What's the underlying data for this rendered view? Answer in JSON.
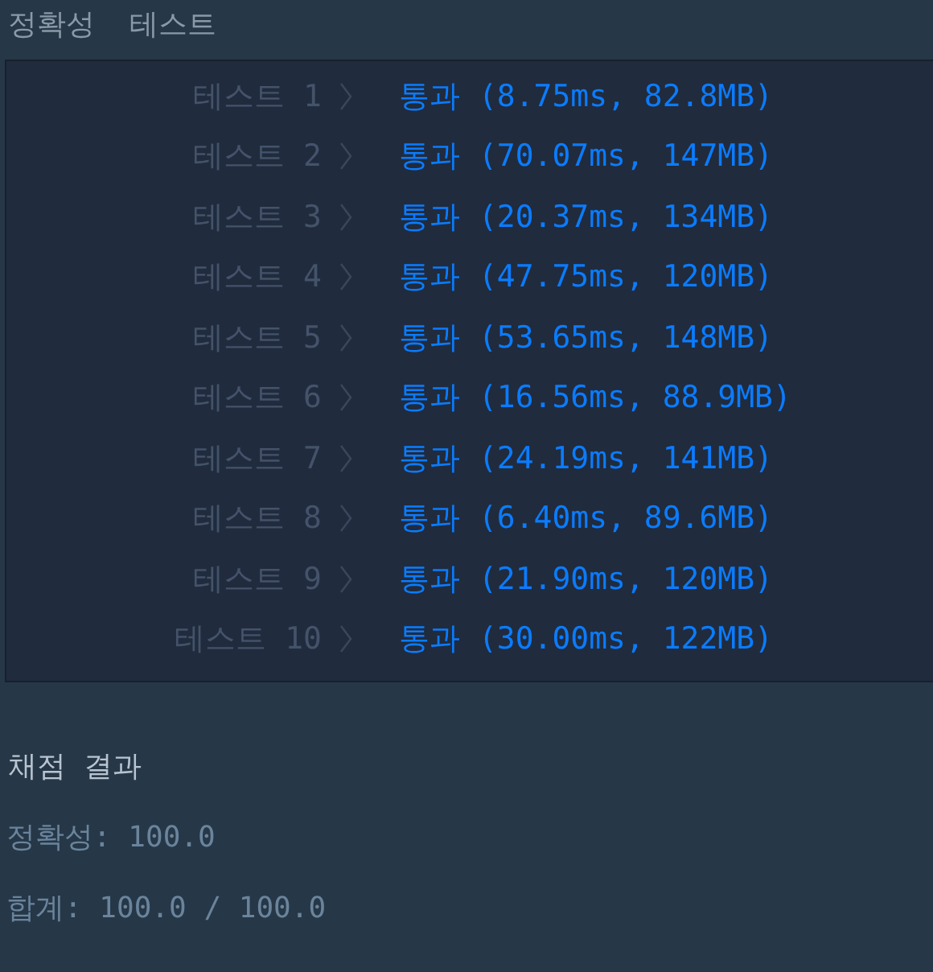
{
  "section_title": "정확성  테스트",
  "tests": [
    {
      "label": "테스트 1",
      "status": "통과",
      "detail": "(8.75ms, 82.8MB)"
    },
    {
      "label": "테스트 2",
      "status": "통과",
      "detail": "(70.07ms, 147MB)"
    },
    {
      "label": "테스트 3",
      "status": "통과",
      "detail": "(20.37ms, 134MB)"
    },
    {
      "label": "테스트 4",
      "status": "통과",
      "detail": "(47.75ms, 120MB)"
    },
    {
      "label": "테스트 5",
      "status": "통과",
      "detail": "(53.65ms, 148MB)"
    },
    {
      "label": "테스트 6",
      "status": "통과",
      "detail": "(16.56ms, 88.9MB)"
    },
    {
      "label": "테스트 7",
      "status": "통과",
      "detail": "(24.19ms, 141MB)"
    },
    {
      "label": "테스트 8",
      "status": "통과",
      "detail": "(6.40ms, 89.6MB)"
    },
    {
      "label": "테스트 9",
      "status": "통과",
      "detail": "(21.90ms, 120MB)"
    },
    {
      "label": "테스트 10",
      "status": "통과",
      "detail": "(30.00ms, 122MB)"
    }
  ],
  "result_title": "채점 결과",
  "result_lines": [
    "정확성: 100.0",
    "합계: 100.0 / 100.0"
  ]
}
